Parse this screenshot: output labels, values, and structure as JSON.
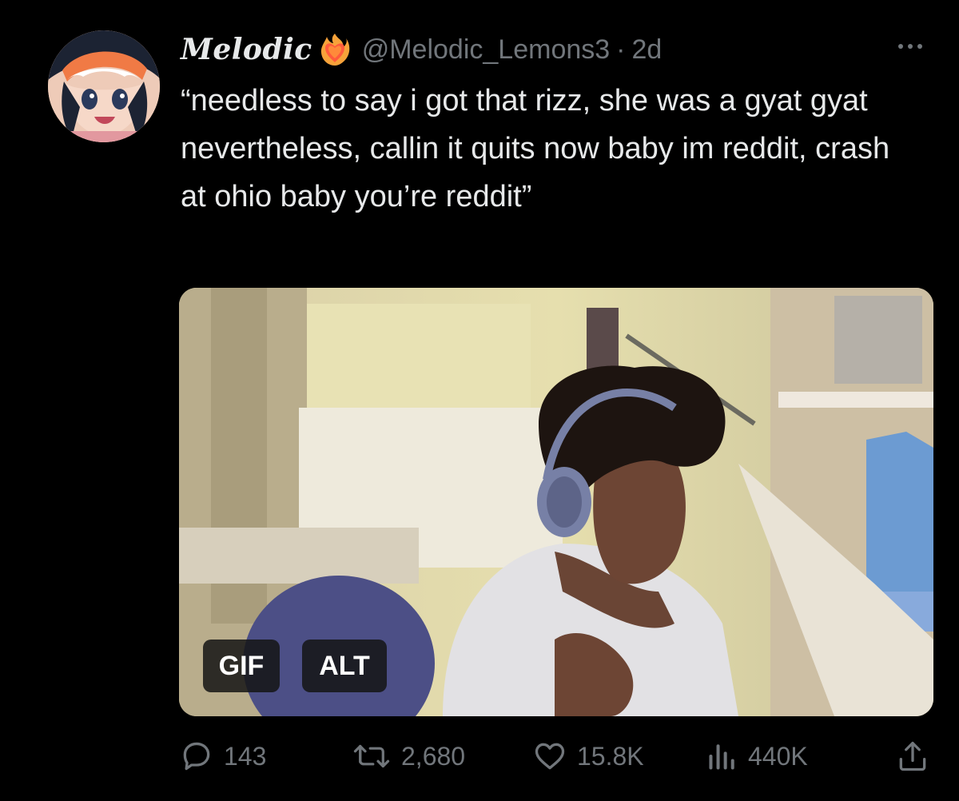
{
  "tweet": {
    "author": {
      "display_name": "Melodic",
      "emoji_icon": "heart-on-fire-icon",
      "handle": "@Melodic_Lemons3",
      "separator": "·",
      "timestamp": "2d"
    },
    "text": "“needless to say i got that rizz, she was a gyat gyat nevertheless, callin it quits now baby im reddit, crash at ohio baby you’re reddit”",
    "media": {
      "type": "gif",
      "badges": {
        "gif": "GIF",
        "alt": "ALT"
      }
    },
    "stats": {
      "replies": "143",
      "reposts": "2,680",
      "likes": "15.8K",
      "views": "440K"
    }
  },
  "colors": {
    "background": "#000000",
    "text": "#e7e9ea",
    "muted": "#71767b"
  }
}
